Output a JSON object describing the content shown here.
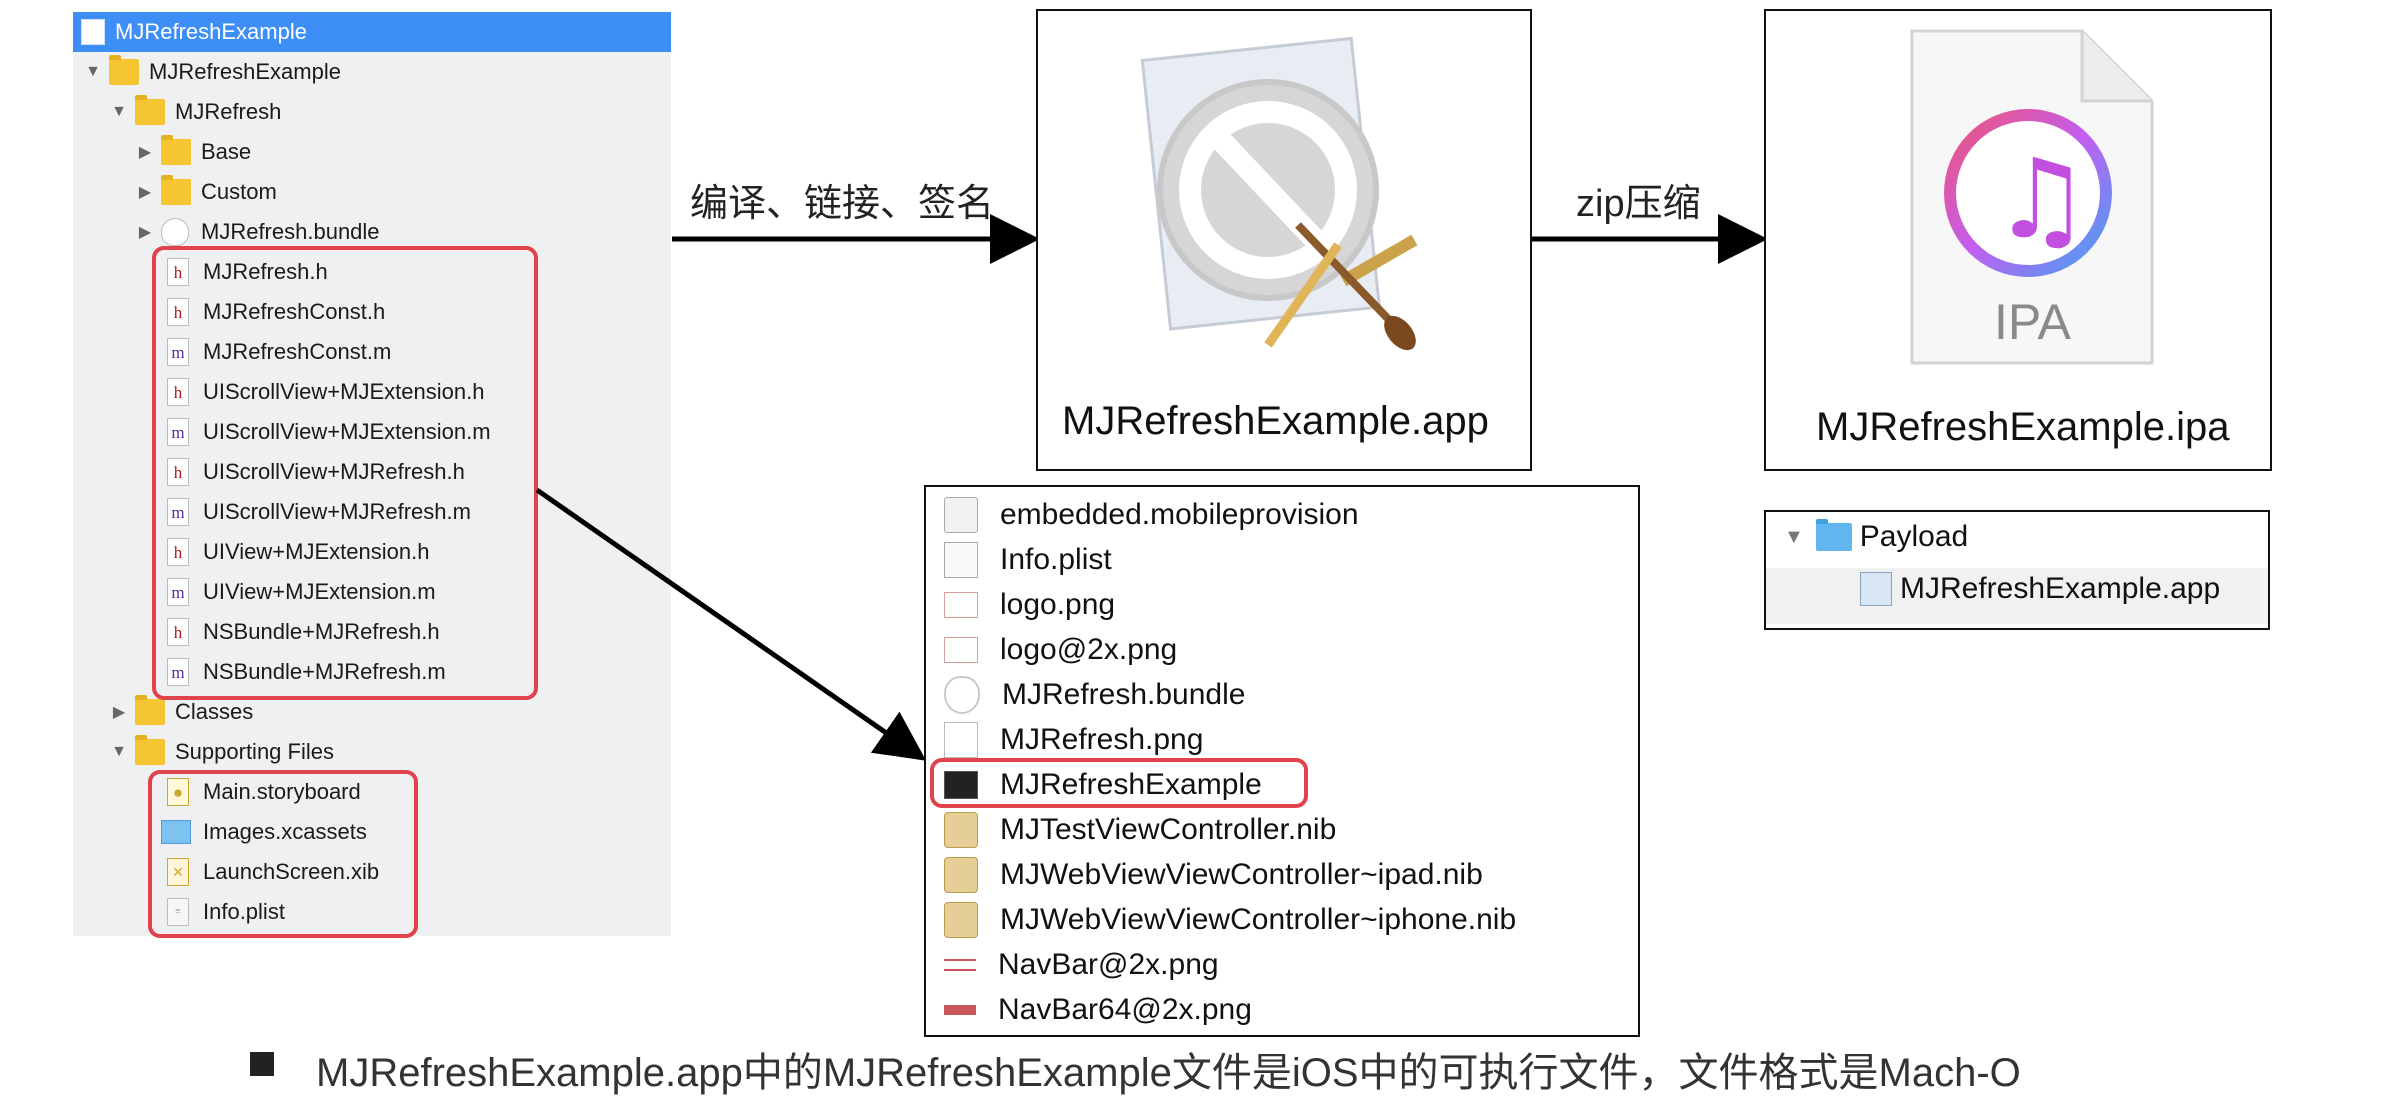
{
  "navigator": {
    "rows": [
      {
        "label": "MJRefreshExample",
        "icon": "xcode-project-icon"
      },
      {
        "label": "MJRefreshExample",
        "icon": "folder-icon"
      },
      {
        "label": "MJRefresh",
        "icon": "folder-icon"
      },
      {
        "label": "Base",
        "icon": "folder-icon"
      },
      {
        "label": "Custom",
        "icon": "folder-icon"
      },
      {
        "label": "MJRefresh.bundle",
        "icon": "bundle-icon"
      },
      {
        "label": "MJRefresh.h",
        "icon": "header-file-icon",
        "glyph": "h"
      },
      {
        "label": "MJRefreshConst.h",
        "icon": "header-file-icon",
        "glyph": "h"
      },
      {
        "label": "MJRefreshConst.m",
        "icon": "source-file-icon",
        "glyph": "m"
      },
      {
        "label": "UIScrollView+MJExtension.h",
        "icon": "header-file-icon",
        "glyph": "h"
      },
      {
        "label": "UIScrollView+MJExtension.m",
        "icon": "source-file-icon",
        "glyph": "m"
      },
      {
        "label": "UIScrollView+MJRefresh.h",
        "icon": "header-file-icon",
        "glyph": "h"
      },
      {
        "label": "UIScrollView+MJRefresh.m",
        "icon": "source-file-icon",
        "glyph": "m"
      },
      {
        "label": "UIView+MJExtension.h",
        "icon": "header-file-icon",
        "glyph": "h"
      },
      {
        "label": "UIView+MJExtension.m",
        "icon": "source-file-icon",
        "glyph": "m"
      },
      {
        "label": "NSBundle+MJRefresh.h",
        "icon": "header-file-icon",
        "glyph": "h"
      },
      {
        "label": "NSBundle+MJRefresh.m",
        "icon": "source-file-icon",
        "glyph": "m"
      },
      {
        "label": "Classes",
        "icon": "folder-icon"
      },
      {
        "label": "Supporting Files",
        "icon": "folder-icon"
      },
      {
        "label": "Main.storyboard",
        "icon": "storyboard-icon"
      },
      {
        "label": "Images.xcassets",
        "icon": "asset-catalog-icon"
      },
      {
        "label": "LaunchScreen.xib",
        "icon": "xib-icon"
      },
      {
        "label": "Info.plist",
        "icon": "plist-icon"
      }
    ]
  },
  "flow": {
    "step1_label": "编译、链接、签名",
    "app_caption": "MJRefreshExample.app",
    "step2_label": "zip压缩",
    "ipa_icon_text": "IPA",
    "ipa_caption": "MJRefreshExample.ipa"
  },
  "app_contents": [
    {
      "label": "embedded.mobileprovision",
      "icon": "provision-file-icon"
    },
    {
      "label": "Info.plist",
      "icon": "plist-icon"
    },
    {
      "label": "logo.png",
      "icon": "png-icon"
    },
    {
      "label": "logo@2x.png",
      "icon": "png-icon"
    },
    {
      "label": "MJRefresh.bundle",
      "icon": "bundle-icon"
    },
    {
      "label": "MJRefresh.png",
      "icon": "image-icon"
    },
    {
      "label": "MJRefreshExample",
      "icon": "executable-icon"
    },
    {
      "label": "MJTestViewController.nib",
      "icon": "nib-icon"
    },
    {
      "label": "MJWebViewViewController~ipad.nib",
      "icon": "nib-icon"
    },
    {
      "label": "MJWebViewViewController~iphone.nib",
      "icon": "nib-icon"
    },
    {
      "label": "NavBar@2x.png",
      "icon": "navbar-png-icon"
    },
    {
      "label": "NavBar64@2x.png",
      "icon": "navbar64-png-icon"
    }
  ],
  "payload": {
    "folder_label": "Payload",
    "child_label": "MJRefreshExample.app"
  },
  "footer": {
    "text": "MJRefreshExample.app中的MJRefreshExample文件是iOS中的可执行文件，文件格式是Mach-O"
  },
  "colors": {
    "highlight": "#e0434b",
    "selection": "#3d8ff7",
    "folder": "#f5c532"
  }
}
